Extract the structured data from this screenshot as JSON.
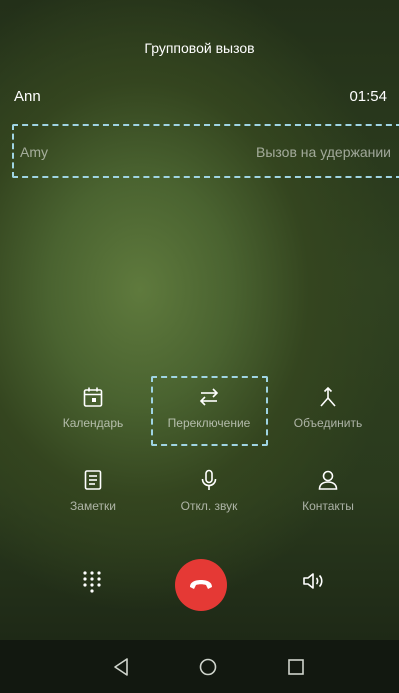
{
  "header": {
    "title": "Групповой вызов"
  },
  "active_call": {
    "name": "Ann",
    "duration": "01:54"
  },
  "held_call": {
    "name": "Amy",
    "status": "Вызов на удержании"
  },
  "actions": {
    "calendar": {
      "label": "Календарь",
      "icon": "calendar-icon"
    },
    "switch": {
      "label": "Переключение",
      "icon": "swap-arrows-icon"
    },
    "merge": {
      "label": "Объединить",
      "icon": "merge-icon"
    },
    "notes": {
      "label": "Заметки",
      "icon": "notes-icon"
    },
    "mute": {
      "label": "Откл. звук",
      "icon": "microphone-icon"
    },
    "contacts": {
      "label": "Контакты",
      "icon": "contact-icon"
    }
  },
  "controls": {
    "keypad_icon": "dialpad-icon",
    "end_call_icon": "end-call-icon",
    "speaker_icon": "speaker-icon"
  },
  "colors": {
    "end_call": "#e53935",
    "highlight": "#9fd4e3"
  },
  "navbar": {
    "back": "back-icon",
    "home": "home-icon",
    "recents": "recents-icon"
  }
}
